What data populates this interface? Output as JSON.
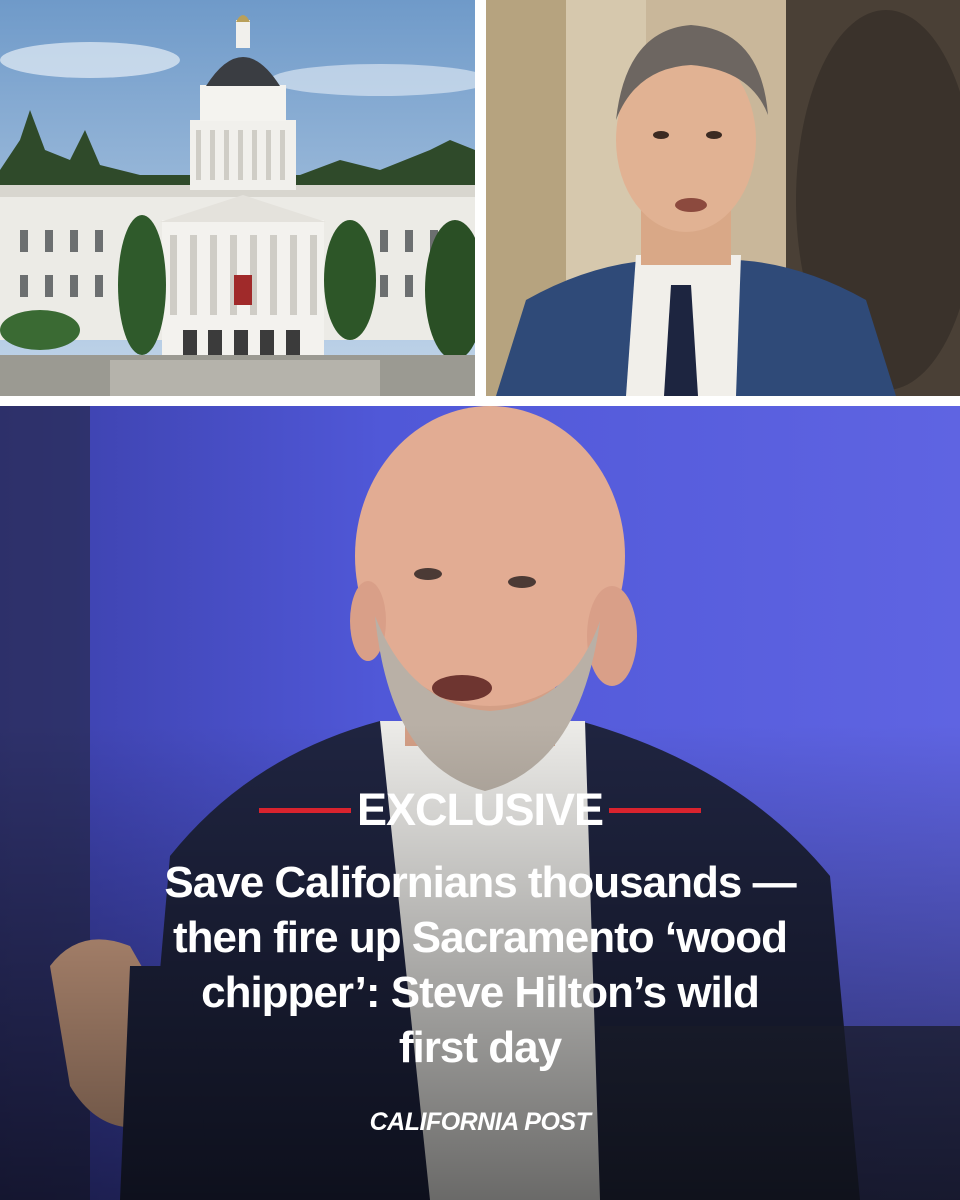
{
  "kicker": "EXCLUSIVE",
  "headline": "Save Californians thousands —\nthen fire up Sacramento ‘wood\nchipper’: Steve Hilton’s wild\nfirst day",
  "brand": "CALIFORNIA POST",
  "colors": {
    "accent_red": "#d9232e",
    "main_background_blue": "#4f55d8",
    "text": "#ffffff"
  },
  "images": {
    "top_left": "capitol-building-photo",
    "top_right": "man-in-suit-portrait-photo",
    "main": "bald-bearded-man-speaking-photo"
  }
}
